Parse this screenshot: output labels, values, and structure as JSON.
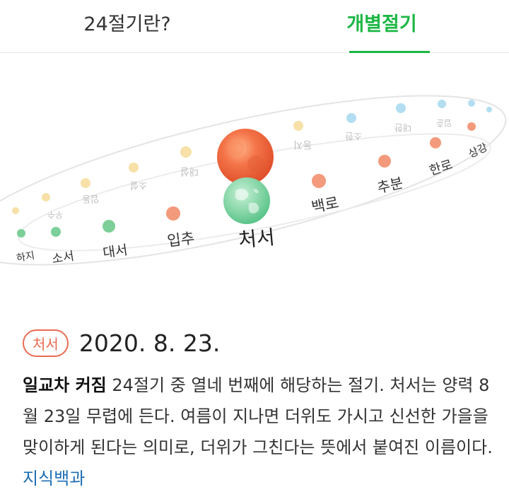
{
  "tabs": {
    "about_label": "24절기란?",
    "individual_label": "개별절기"
  },
  "orbit": {
    "current_term": "처서",
    "back_terms": [
      "우수",
      "경칩",
      "춘분",
      "청명",
      "곡우",
      "입하",
      "소만",
      "망종",
      "하지",
      "소서",
      "대서",
      "입추",
      "처서",
      "백로",
      "추분",
      "한로",
      "상강",
      "입동",
      "소설",
      "대설",
      "동지",
      "소한",
      "대한",
      "입춘"
    ],
    "front_labels": {
      "haji": "하지",
      "soseo": "소서",
      "daeseo": "대서",
      "ipchu": "입추",
      "cheoseo": "처서",
      "baengno": "백로",
      "chubun": "추분",
      "hanro": "한로",
      "sanggang": "상강"
    },
    "colors": {
      "spring": "#f5d78c",
      "summer": "#7ccf98",
      "autumn": "#f39a7c",
      "winter": "#9ad4ee"
    }
  },
  "detail": {
    "badge": "처서",
    "date": "2020. 8. 23.",
    "keyword": "일교차 커짐",
    "description": " 24절기 중 열네 번째에 해당하는 절기. 처서는 양력 8월 23일 무렵에 든다. 여름이 지나면 더위도 가시고 신선한 가을을 맞이하게 된다는 의미로, 더위가 그친다는 뜻에서 붙여진 이름이다. ",
    "link": "지식백과"
  }
}
